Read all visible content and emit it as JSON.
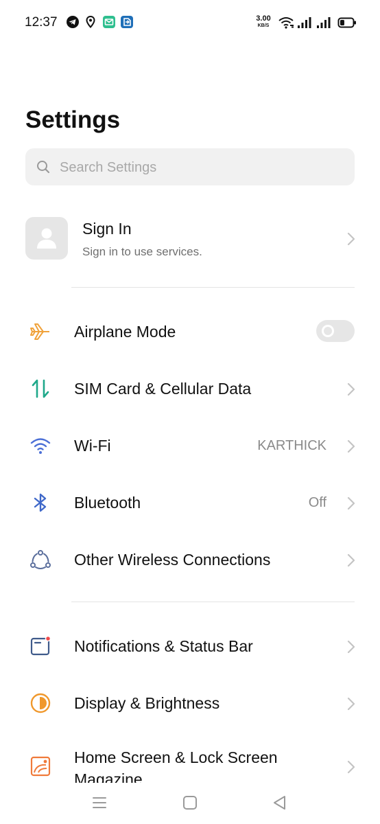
{
  "status_bar": {
    "time": "12:37",
    "net_speed_value": "3.00",
    "net_speed_unit": "KB/S",
    "icons": [
      "telegram-icon",
      "location-icon",
      "mail-app-icon",
      "app-icon",
      "wifi-icon",
      "signal-icon",
      "signal-icon",
      "battery-icon"
    ],
    "battery_level": 0.35
  },
  "header": {
    "title": "Settings"
  },
  "search": {
    "placeholder": "Search Settings",
    "value": ""
  },
  "account": {
    "title": "Sign In",
    "subtitle": "Sign in to use services."
  },
  "settings": {
    "airplane": {
      "label": "Airplane Mode",
      "icon": "airplane-icon",
      "enabled": false
    },
    "sim": {
      "label": "SIM Card & Cellular Data",
      "icon": "sim-data-icon"
    },
    "wifi": {
      "label": "Wi-Fi",
      "value": "KARTHICK",
      "icon": "wifi-icon"
    },
    "bluetooth": {
      "label": "Bluetooth",
      "value": "Off",
      "icon": "bluetooth-icon"
    },
    "wireless": {
      "label": "Other Wireless Connections",
      "icon": "connections-icon"
    },
    "notifications": {
      "label": "Notifications & Status Bar",
      "icon": "notification-icon"
    },
    "display": {
      "label": "Display & Brightness",
      "icon": "display-brightness-icon"
    },
    "home": {
      "label": "Home Screen & Lock Screen Magazine",
      "icon": "home-screen-icon"
    }
  },
  "nav_bar": {
    "buttons": [
      "menu-icon",
      "home-icon",
      "back-icon"
    ]
  },
  "colors": {
    "airplane": "#f0a23b",
    "sim": "#1fa88a",
    "wifi": "#4b6fd6",
    "bluetooth": "#3f68c9",
    "connections": "#5a6e9c",
    "notifications": "#3e5a8a",
    "notification_dot": "#f04a4a",
    "display": "#f0982c",
    "home_screen": "#f07a3a",
    "search_bg": "#f1f1f1",
    "secondary_text": "#8a8a8a"
  }
}
